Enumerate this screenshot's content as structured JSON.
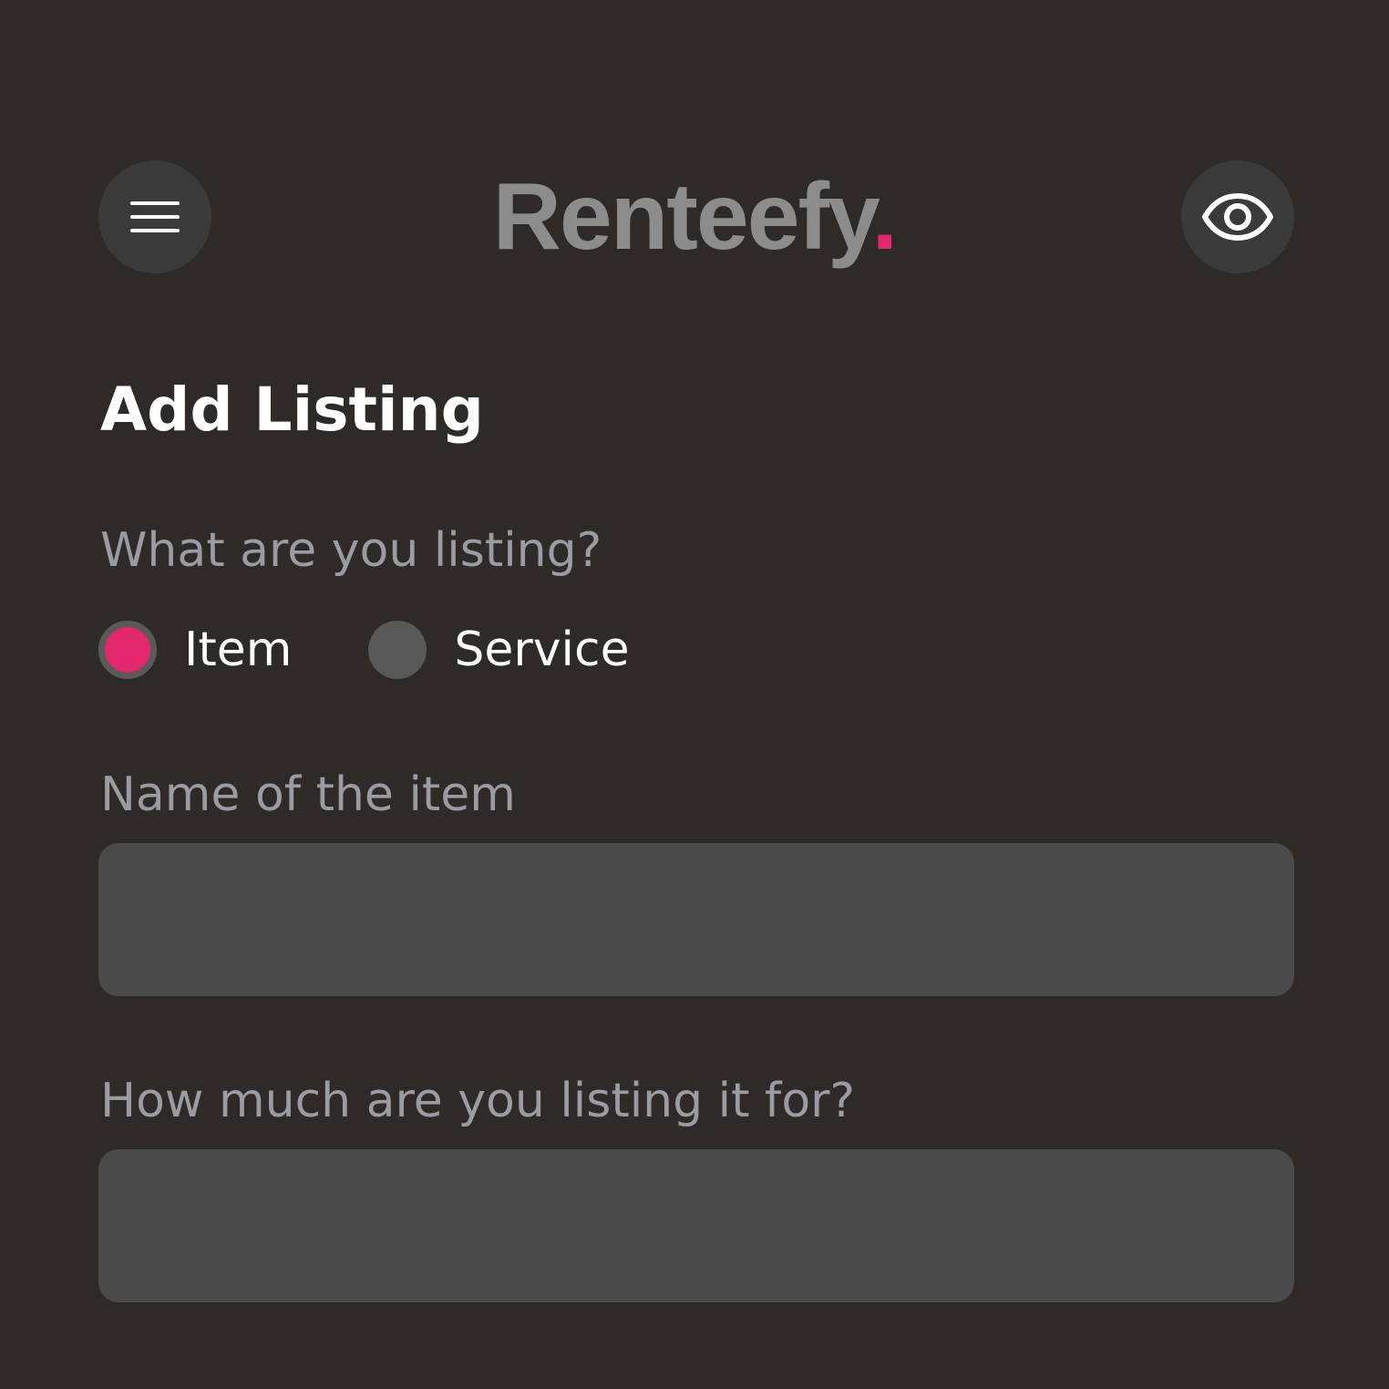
{
  "header": {
    "brand": "Renteefy",
    "brand_dot": ".",
    "menu_icon": "hamburger-menu-icon",
    "preview_icon": "eye-icon"
  },
  "colors": {
    "background": "#2d2a28",
    "accent": "#e0286a",
    "field_background": "#4a4a4a",
    "label": "#9a9ba3"
  },
  "page": {
    "title": "Add Listing"
  },
  "listing_type": {
    "question": "What are you listing?",
    "options": [
      {
        "label": "Item",
        "selected": true
      },
      {
        "label": "Service",
        "selected": false
      }
    ]
  },
  "name_field": {
    "label": "Name of the item",
    "value": "",
    "placeholder": ""
  },
  "price_field": {
    "label": "How much are you listing it for?",
    "value": "",
    "placeholder": ""
  }
}
